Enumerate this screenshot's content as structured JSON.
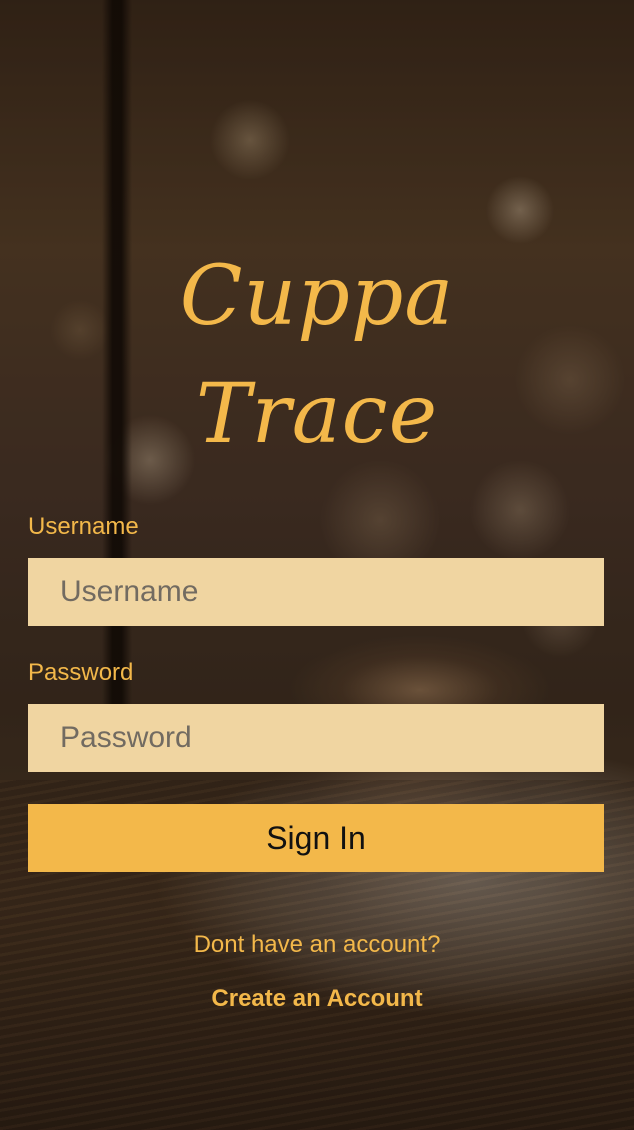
{
  "app": {
    "logo_line1": "Cuppa",
    "logo_line2": "Trace"
  },
  "form": {
    "username_label": "Username",
    "username_placeholder": "Username",
    "username_value": "",
    "password_label": "Password",
    "password_placeholder": "Password",
    "password_value": "",
    "signin_label": "Sign In"
  },
  "footer": {
    "prompt": "Dont have an account?",
    "create_account_label": "Create an Account"
  },
  "colors": {
    "accent": "#f3b84a",
    "input_background": "#f0d5a1",
    "button_text": "#111111"
  }
}
